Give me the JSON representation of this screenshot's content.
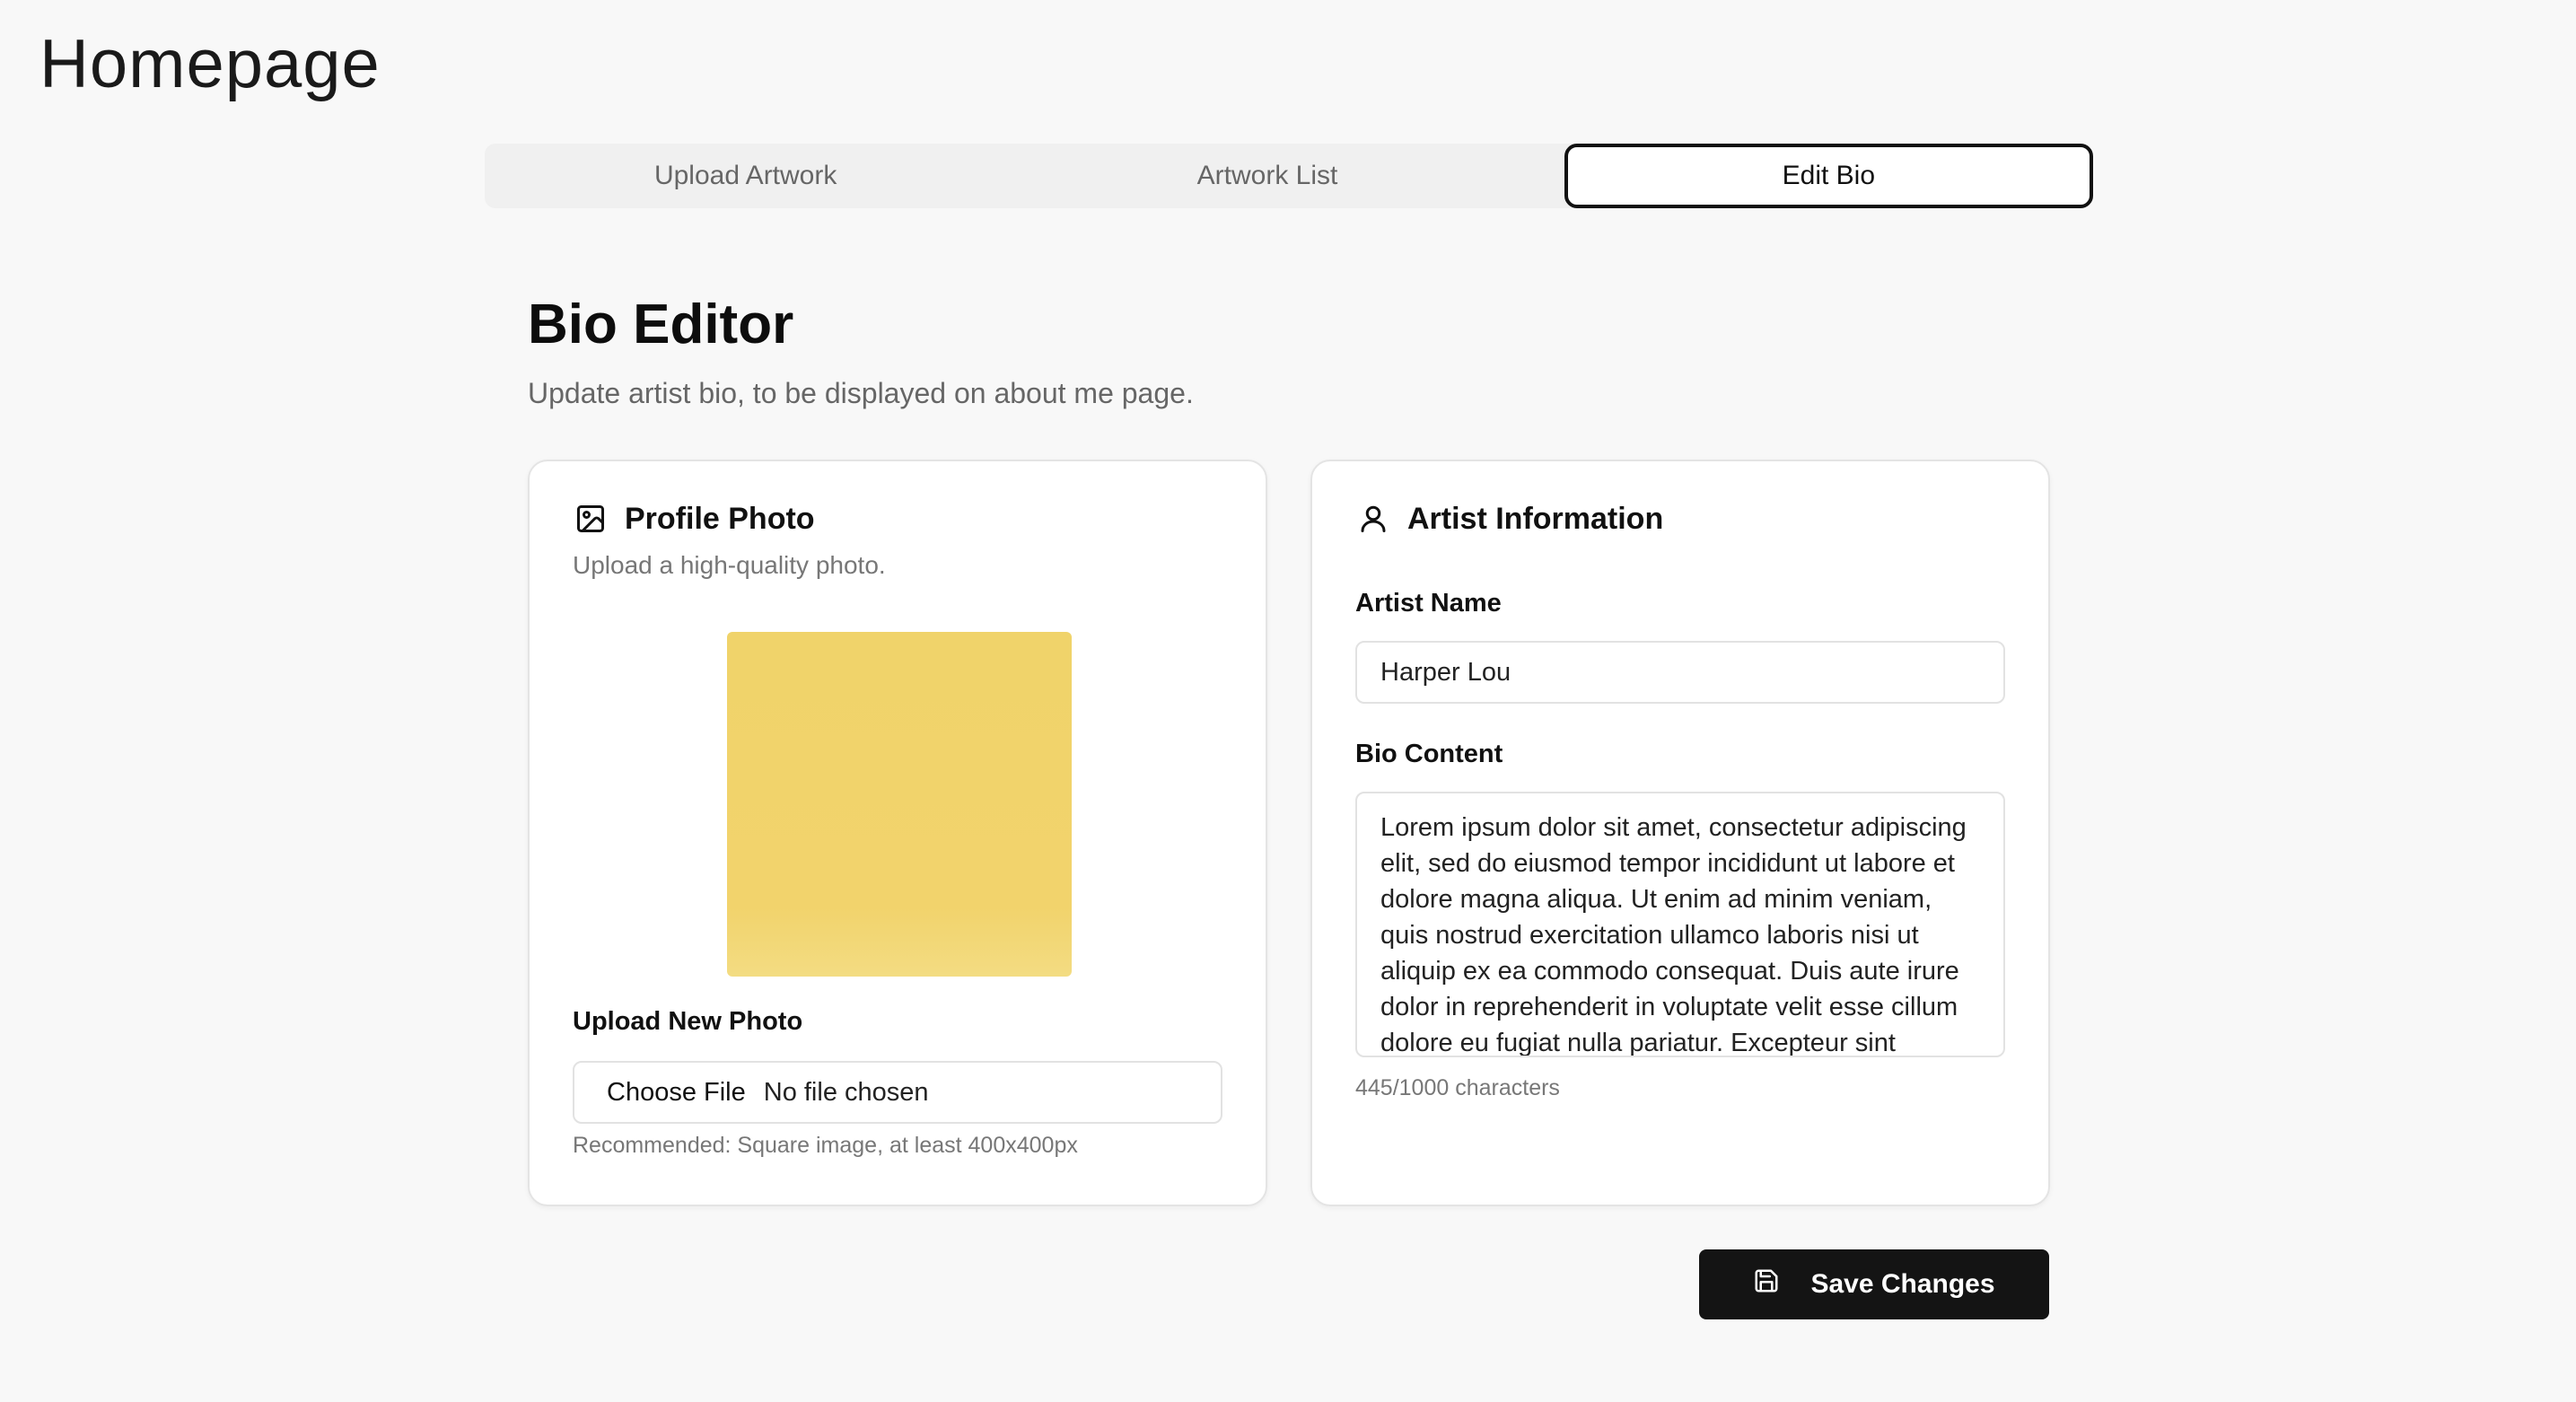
{
  "page": {
    "title": "Homepage"
  },
  "tabs": [
    {
      "label": "Upload Artwork"
    },
    {
      "label": "Artwork List"
    },
    {
      "label": "Edit Bio"
    }
  ],
  "section": {
    "title": "Bio Editor",
    "subtitle": "Update artist bio, to be displayed on about me page."
  },
  "profile_card": {
    "title": "Profile Photo",
    "icon": "image-icon",
    "description": "Upload a high-quality photo.",
    "photo_color": "#f1d36b",
    "upload_label": "Upload New Photo",
    "choose_file_label": "Choose File",
    "file_status": "No file chosen",
    "hint": "Recommended: Square image, at least 400x400px"
  },
  "artist_card": {
    "title": "Artist Information",
    "icon": "user-icon",
    "name_label": "Artist Name",
    "name_value": "Harper Lou",
    "bio_label": "Bio Content",
    "bio_value": "Lorem ipsum dolor sit amet, consectetur adipiscing elit, sed do eiusmod tempor incididunt ut labore et dolore magna aliqua. Ut enim ad minim veniam, quis nostrud exercitation ullamco laboris nisi ut aliquip ex ea commodo consequat. Duis aute irure dolor in reprehenderit in voluptate velit esse cillum dolore eu fugiat nulla pariatur. Excepteur sint occaecat cupidatat non proident, sunt in culpa qui officia deserunt mollit anim id est laborum.",
    "char_count": "445/1000 characters"
  },
  "actions": {
    "save_label": "Save Changes",
    "save_icon": "save-icon"
  },
  "colors": {
    "accent": "#141414",
    "background": "#f8f8f8"
  }
}
